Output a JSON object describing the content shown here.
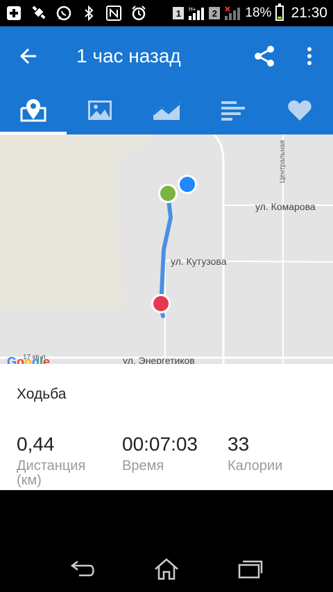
{
  "status_bar": {
    "sim1": "1",
    "sim2": "2",
    "battery_percent": "18%",
    "time": "21:30",
    "battery_level": 0.18
  },
  "app_bar": {
    "title": "1 час назад",
    "back_icon": "arrow-left-icon",
    "share_icon": "share-icon",
    "more_icon": "more-vert-icon"
  },
  "tabs": [
    {
      "icon": "map-icon",
      "active": true
    },
    {
      "icon": "image-icon",
      "active": false
    },
    {
      "icon": "chart-icon",
      "active": false
    },
    {
      "icon": "list-icon",
      "active": false
    },
    {
      "icon": "heart-icon",
      "active": false
    }
  ],
  "map": {
    "streets": {
      "komarova": "ул. Комарова",
      "kutuzova": "ул. Кутузова",
      "energetikov": "ул. Энергетиков",
      "centralnaya": "Центральная",
      "block": "17 кв-л"
    },
    "google_logo": "Google",
    "colors": {
      "route": "#4A90E2",
      "start_marker": "#7CB342",
      "end_marker": "#E53950",
      "location_marker": "#1E88FF"
    }
  },
  "activity": {
    "type": "Ходьба",
    "distance_value": "0,44",
    "distance_label": "Дистанция",
    "distance_unit": "(км)",
    "time_value": "00:07:03",
    "time_label": "Время",
    "calories_value": "33",
    "calories_label": "Калории"
  },
  "nav_bar": {
    "back_icon": "back-icon",
    "home_icon": "home-icon",
    "recents_icon": "recents-icon"
  },
  "colors": {
    "primary": "#1976D2"
  }
}
